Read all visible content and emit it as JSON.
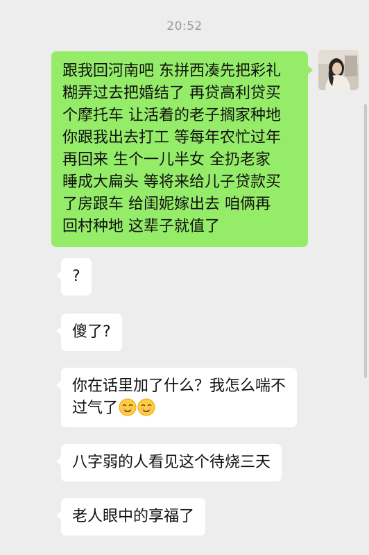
{
  "chat": {
    "timestamp": "20:52",
    "sent_message": {
      "lines": [
        "跟我回河南吧  东拼西凑先把彩礼",
        "糊弄过去把婚结了   再贷高利贷买",
        "个摩托车  让活着的老子搁家种地",
        "你跟我出去打工   等每年农忙过年",
        "再回来   生个一儿半女  全扔老家",
        "睡成大扁头   等将来给儿子贷款买",
        "了房跟车   给闺妮嫁出去  咱俩再",
        "回村种地  这辈子就值了"
      ]
    },
    "received_messages": [
      {
        "text": "?"
      },
      {
        "text": "傻了?"
      },
      {
        "line1": "你在话里加了什么？我怎么喘不",
        "line2": "过气了",
        "emojis": [
          "smiling-face",
          "smiling-face"
        ]
      },
      {
        "text": "八字弱的人看见这个待烧三天"
      },
      {
        "text": "老人眼中的享福了"
      }
    ]
  },
  "colors": {
    "background": "#ededed",
    "sent_bubble": "#95ec69",
    "received_bubble": "#ffffff",
    "timestamp_text": "#9a9a9a"
  }
}
